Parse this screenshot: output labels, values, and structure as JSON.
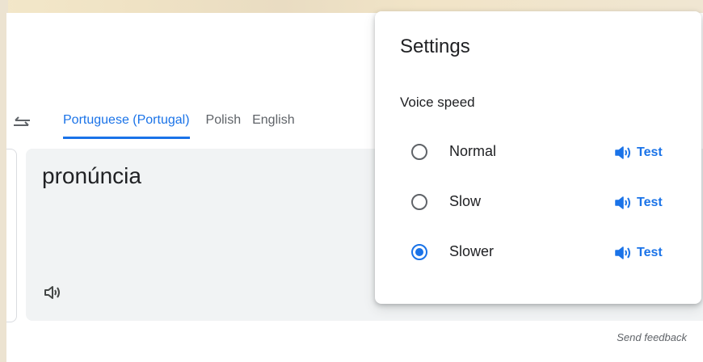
{
  "languages": {
    "tabs": [
      {
        "label": "Portuguese (Portugal)"
      },
      {
        "label": "Polish"
      },
      {
        "label": "English"
      }
    ],
    "active_index": 0
  },
  "output": {
    "text": "pronúncia"
  },
  "footer": {
    "send_feedback": "Send feedback"
  },
  "settings": {
    "title": "Settings",
    "section_label": "Voice speed",
    "options": [
      {
        "label": "Normal",
        "test_label": "Test",
        "selected": false
      },
      {
        "label": "Slow",
        "test_label": "Test",
        "selected": false
      },
      {
        "label": "Slower",
        "test_label": "Test",
        "selected": true
      }
    ]
  },
  "colors": {
    "accent": "#1a73e8",
    "text_primary": "#202124",
    "text_secondary": "#5f6368",
    "output_bg": "#f1f3f4"
  },
  "icons": {
    "swap": "swap-languages-icon",
    "chevron": "chevron-down-icon",
    "speaker": "speaker-icon"
  }
}
